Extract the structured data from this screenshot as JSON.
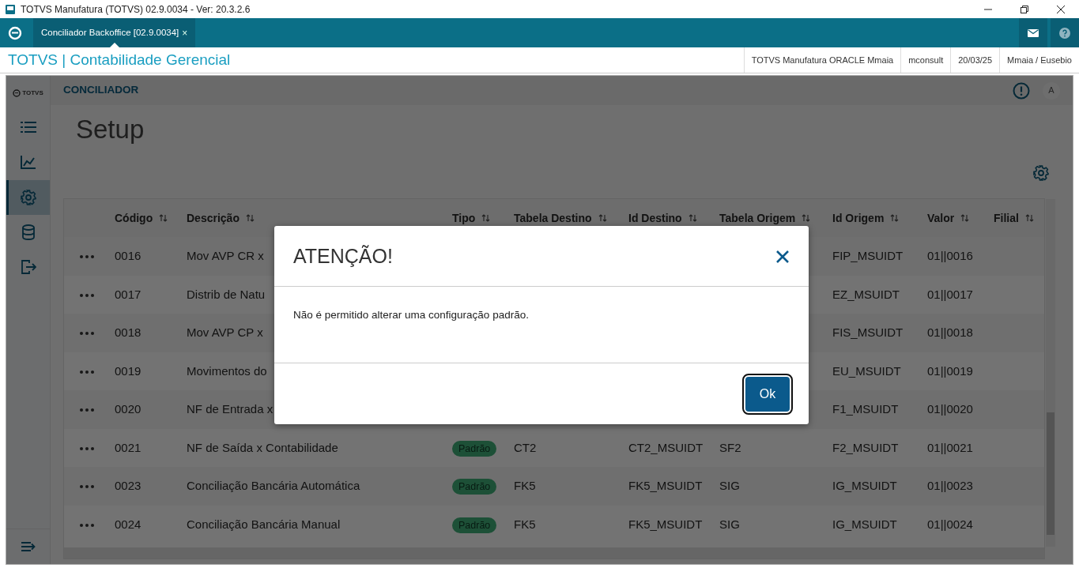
{
  "window": {
    "title": "TOTVS Manufatura (TOTVS) 02.9.0034 - Ver: 20.3.2.6"
  },
  "tabs": [
    {
      "label": "Conciliador Backoffice [02.9.0034]",
      "close": "×",
      "selected": true
    }
  ],
  "app_header": {
    "title": "TOTVS | Contabilidade Gerencial",
    "info": [
      "TOTVS Manufatura ORACLE Mmaia",
      "mconsult",
      "20/03/25",
      "Mmaia / Eusebio"
    ]
  },
  "sidebar": {
    "logo": "TOTVS",
    "items": [
      {
        "kind": "list",
        "selected": false
      },
      {
        "kind": "chart",
        "selected": false
      },
      {
        "kind": "gear",
        "selected": true
      },
      {
        "kind": "database",
        "selected": false
      },
      {
        "kind": "logout",
        "selected": false
      }
    ]
  },
  "page": {
    "breadcrumb": "CONCILIADOR",
    "avatar": "A",
    "title": "Setup"
  },
  "table": {
    "columns": [
      "Código",
      "Descrição",
      "Tipo",
      "Tabela Destino",
      "Id Destino",
      "Tabela Origem",
      "Id Origem",
      "Valor",
      "Filial"
    ],
    "rows": [
      {
        "code": "0016",
        "description": "Mov AVP CR x",
        "id_origem": "FIP_MSUIDT",
        "valor": "01||0016"
      },
      {
        "code": "0017",
        "description": "Distrib de Natu",
        "id_origem": "EZ_MSUIDT",
        "valor": "01||0017"
      },
      {
        "code": "0018",
        "description": "Mov AVP CP x",
        "id_origem": "FIS_MSUIDT",
        "valor": "01||0018"
      },
      {
        "code": "0019",
        "description": "Movimentos do",
        "id_origem": "EU_MSUIDT",
        "valor": "01||0019"
      },
      {
        "code": "0020",
        "description": "NF de Entrada x",
        "id_origem": "F1_MSUIDT",
        "valor": "01||0020"
      },
      {
        "code": "0021",
        "description": "NF de Saída x Contabilidade",
        "tipo": "Padrão",
        "tabela_destino": "CT2",
        "id_destino": "CT2_MSUIDT",
        "tabela_origem": "SF2",
        "id_origem": "F2_MSUIDT",
        "valor": "01||0021"
      },
      {
        "code": "0023",
        "description": "Conciliação Bancária Automática",
        "tipo": "Padrão",
        "tabela_destino": "FK5",
        "id_destino": "FK5_MSUIDT",
        "tabela_origem": "SIG",
        "id_origem": "IG_MSUIDT",
        "valor": "01||0023"
      },
      {
        "code": "0024",
        "description": "Conciliação Bancária Manual",
        "tipo": "Padrão",
        "tabela_destino": "FK5",
        "id_destino": "FK5_MSUIDT",
        "tabela_origem": "SIG",
        "id_origem": "IG_MSUIDT",
        "valor": "01||0024"
      }
    ]
  },
  "dialog": {
    "title": "ATENÇÃO!",
    "message": "Não é permitido alterar uma configuração padrão.",
    "button": "Ok"
  }
}
